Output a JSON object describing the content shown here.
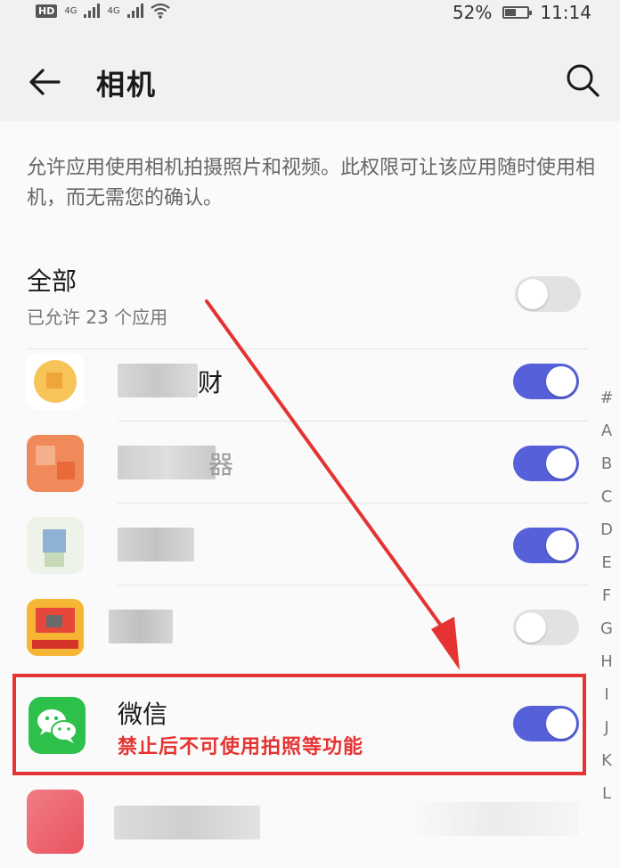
{
  "status_bar": {
    "badge": "HD",
    "net1": "4G",
    "net2": "4G",
    "battery_percent": "52%",
    "battery_level": 0.52,
    "time": "11:14"
  },
  "titlebar": {
    "title": "相机",
    "back_icon": "arrow-left-icon",
    "search_icon": "search-icon"
  },
  "description": "允许应用使用相机拍摄照片和视频。此权限可让该应用随时使用相机，而无需您的确认。",
  "all_apps": {
    "title": "全部",
    "subtitle": "已允许 23 个应用",
    "toggle_on": false
  },
  "apps": [
    {
      "name_visible_end": "财",
      "toggle_on": true
    },
    {
      "name_visible_end": "器",
      "toggle_on": true
    },
    {
      "name_visible_end": "",
      "toggle_on": true
    },
    {
      "name_visible_end": "",
      "toggle_on": false
    }
  ],
  "wechat": {
    "name": "微信",
    "note": "禁止后不可使用拍照等功能",
    "toggle_on": true
  },
  "alpha_index": [
    "#",
    "A",
    "B",
    "C",
    "D",
    "E",
    "F",
    "G",
    "H",
    "I",
    "J",
    "K",
    "L"
  ],
  "colors": {
    "toggle_on": "#5560d9",
    "toggle_off": "#e2e2e2",
    "annotation_red": "#e53333",
    "wechat_green": "#2dc14b"
  }
}
